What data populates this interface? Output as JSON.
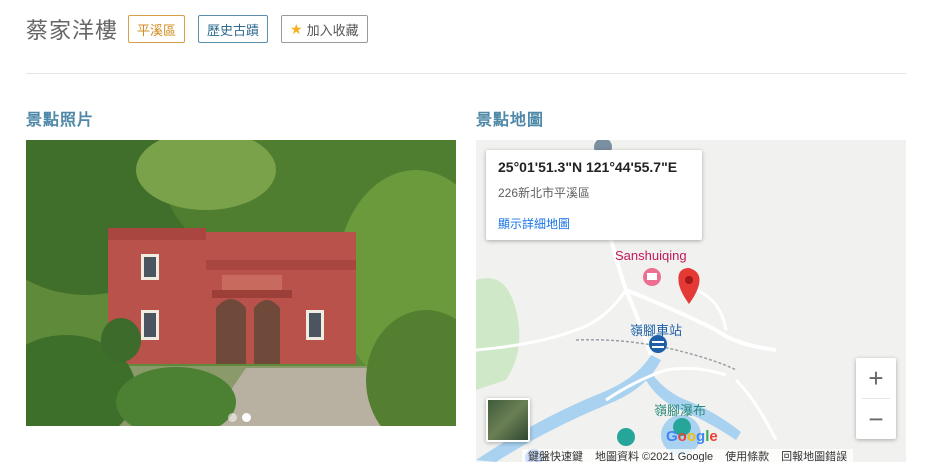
{
  "header": {
    "title": "蔡家洋樓",
    "tags": [
      "平溪區",
      "歷史古蹟"
    ],
    "favorite_label": "加入收藏",
    "favorite_icon": "star-icon"
  },
  "photo_section": {
    "title": "景點照片",
    "carousel": {
      "total": 2,
      "active_index": 1
    }
  },
  "map_section": {
    "title": "景點地圖",
    "info_card": {
      "coordinates": "25°01'51.3\"N 121°44'55.7\"E",
      "address": "226新北市平溪區",
      "link": "顯示詳細地圖"
    },
    "labels": {
      "place": "Sanshuiqing",
      "station": "嶺腳車站",
      "waterfall": "嶺腳瀑布"
    },
    "controls": {
      "zoom_in": "+",
      "zoom_out": "−"
    },
    "google_logo": "Google",
    "footer": {
      "shortcuts": "鍵盤快速鍵",
      "data": "地圖資料 ©2021 Google",
      "terms": "使用條款",
      "report": "回報地圖錯誤"
    },
    "colors": {
      "pin": "#e53935",
      "place_label": "#c2185b",
      "station_label": "#1d5fa8",
      "waterfall_label": "#2b8a7e"
    }
  }
}
